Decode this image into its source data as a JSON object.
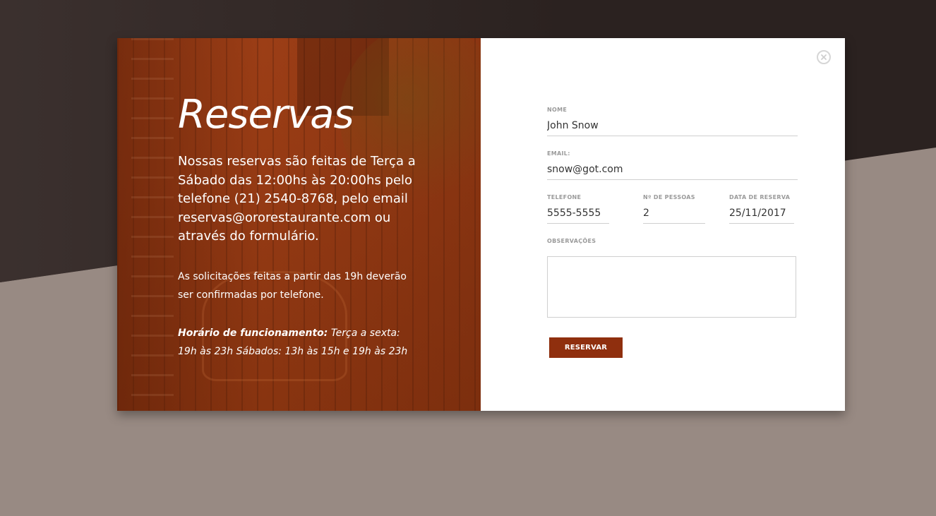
{
  "colors": {
    "background_dark": "#2b2220",
    "background_light": "#988a83",
    "panel_brown": "#963b14",
    "button_brown": "#8f2f0e",
    "label_gray": "#9a9a9a"
  },
  "icons": {
    "close": "close-icon"
  },
  "info": {
    "title": "Reservas",
    "lead": "Nossas reservas são feitas de Terça a Sábado das 12:00hs às 20:00hs pelo telefone (21) 2540-8768, pelo email reservas@ororestaurante.com ou através do formulário.",
    "note": "As solicitações feitas a partir das 19h deverão ser confirmadas por telefone.",
    "hours_label": "Horário de funcionamento:",
    "hours_text": " Terça a sexta: 19h às 23h Sábados: 13h às 15h e 19h às 23h"
  },
  "form": {
    "nome_label": "NOME",
    "nome_value": "John Snow",
    "email_label": "EMAIL:",
    "email_value": "snow@got.com",
    "telefone_label": "TELEFONE",
    "telefone_value": "5555-5555",
    "pessoas_label": "Nº DE PESSOAS",
    "pessoas_value": "2",
    "data_label": "DATA DE RESERVA",
    "data_value": "25/11/2017",
    "obs_label": "OBSERVAÇÕES",
    "obs_value": "",
    "submit_label": "RESERVAR"
  }
}
